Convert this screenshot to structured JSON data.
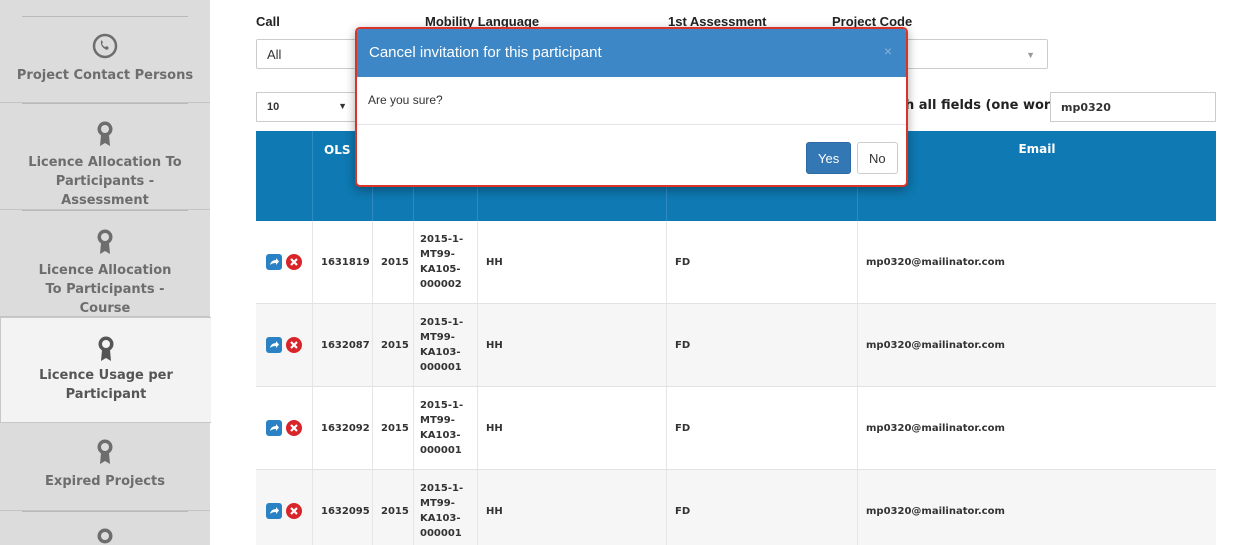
{
  "sidebar": {
    "items": [
      {
        "label": "Project Contact Persons",
        "icon": "phone-icon",
        "active": false
      },
      {
        "label": "Licence Allocation To Participants - Assessment",
        "icon": "ribbon-icon",
        "active": false
      },
      {
        "label": "Licence Allocation To Participants - Course",
        "icon": "ribbon-icon",
        "active": false
      },
      {
        "label": "Licence Usage per Participant",
        "icon": "ribbon-icon",
        "active": true
      },
      {
        "label": "Expired Projects",
        "icon": "ribbon-icon",
        "active": false
      }
    ]
  },
  "filters": {
    "call_label": "Call",
    "call_value": "All",
    "mobility_language_label": "Mobility Language",
    "first_assessment_label": "1st Assessment",
    "project_code_label": "Project Code"
  },
  "table_controls": {
    "page_length": "10",
    "search_label": "h all fields (one word)",
    "search_value": "mp0320"
  },
  "table": {
    "headers": {
      "ols": "OLS I",
      "email": "Email"
    },
    "rows": [
      {
        "ols_id": "1631819",
        "year": "2015",
        "project": [
          "2015-1-",
          "MT99-",
          "KA105-",
          "000002"
        ],
        "col4": "HH",
        "col5": "FD",
        "email": "mp0320@mailinator.com"
      },
      {
        "ols_id": "1632087",
        "year": "2015",
        "project": [
          "2015-1-",
          "MT99-",
          "KA103-",
          "000001"
        ],
        "col4": "HH",
        "col5": "FD",
        "email": "mp0320@mailinator.com"
      },
      {
        "ols_id": "1632092",
        "year": "2015",
        "project": [
          "2015-1-",
          "MT99-",
          "KA103-",
          "000001"
        ],
        "col4": "HH",
        "col5": "FD",
        "email": "mp0320@mailinator.com"
      },
      {
        "ols_id": "1632095",
        "year": "2015",
        "project": [
          "2015-1-",
          "MT99-",
          "KA103-",
          "000001"
        ],
        "col4": "HH",
        "col5": "FD",
        "email": "mp0320@mailinator.com"
      }
    ]
  },
  "modal": {
    "title": "Cancel invitation for this participant",
    "close": "×",
    "body": "Are you sure?",
    "yes": "Yes",
    "no": "No"
  },
  "colors": {
    "header_blue": "#0e79b2",
    "modal_header": "#3d87c6",
    "modal_border": "#d9342b",
    "delete_red": "#d9242a"
  }
}
